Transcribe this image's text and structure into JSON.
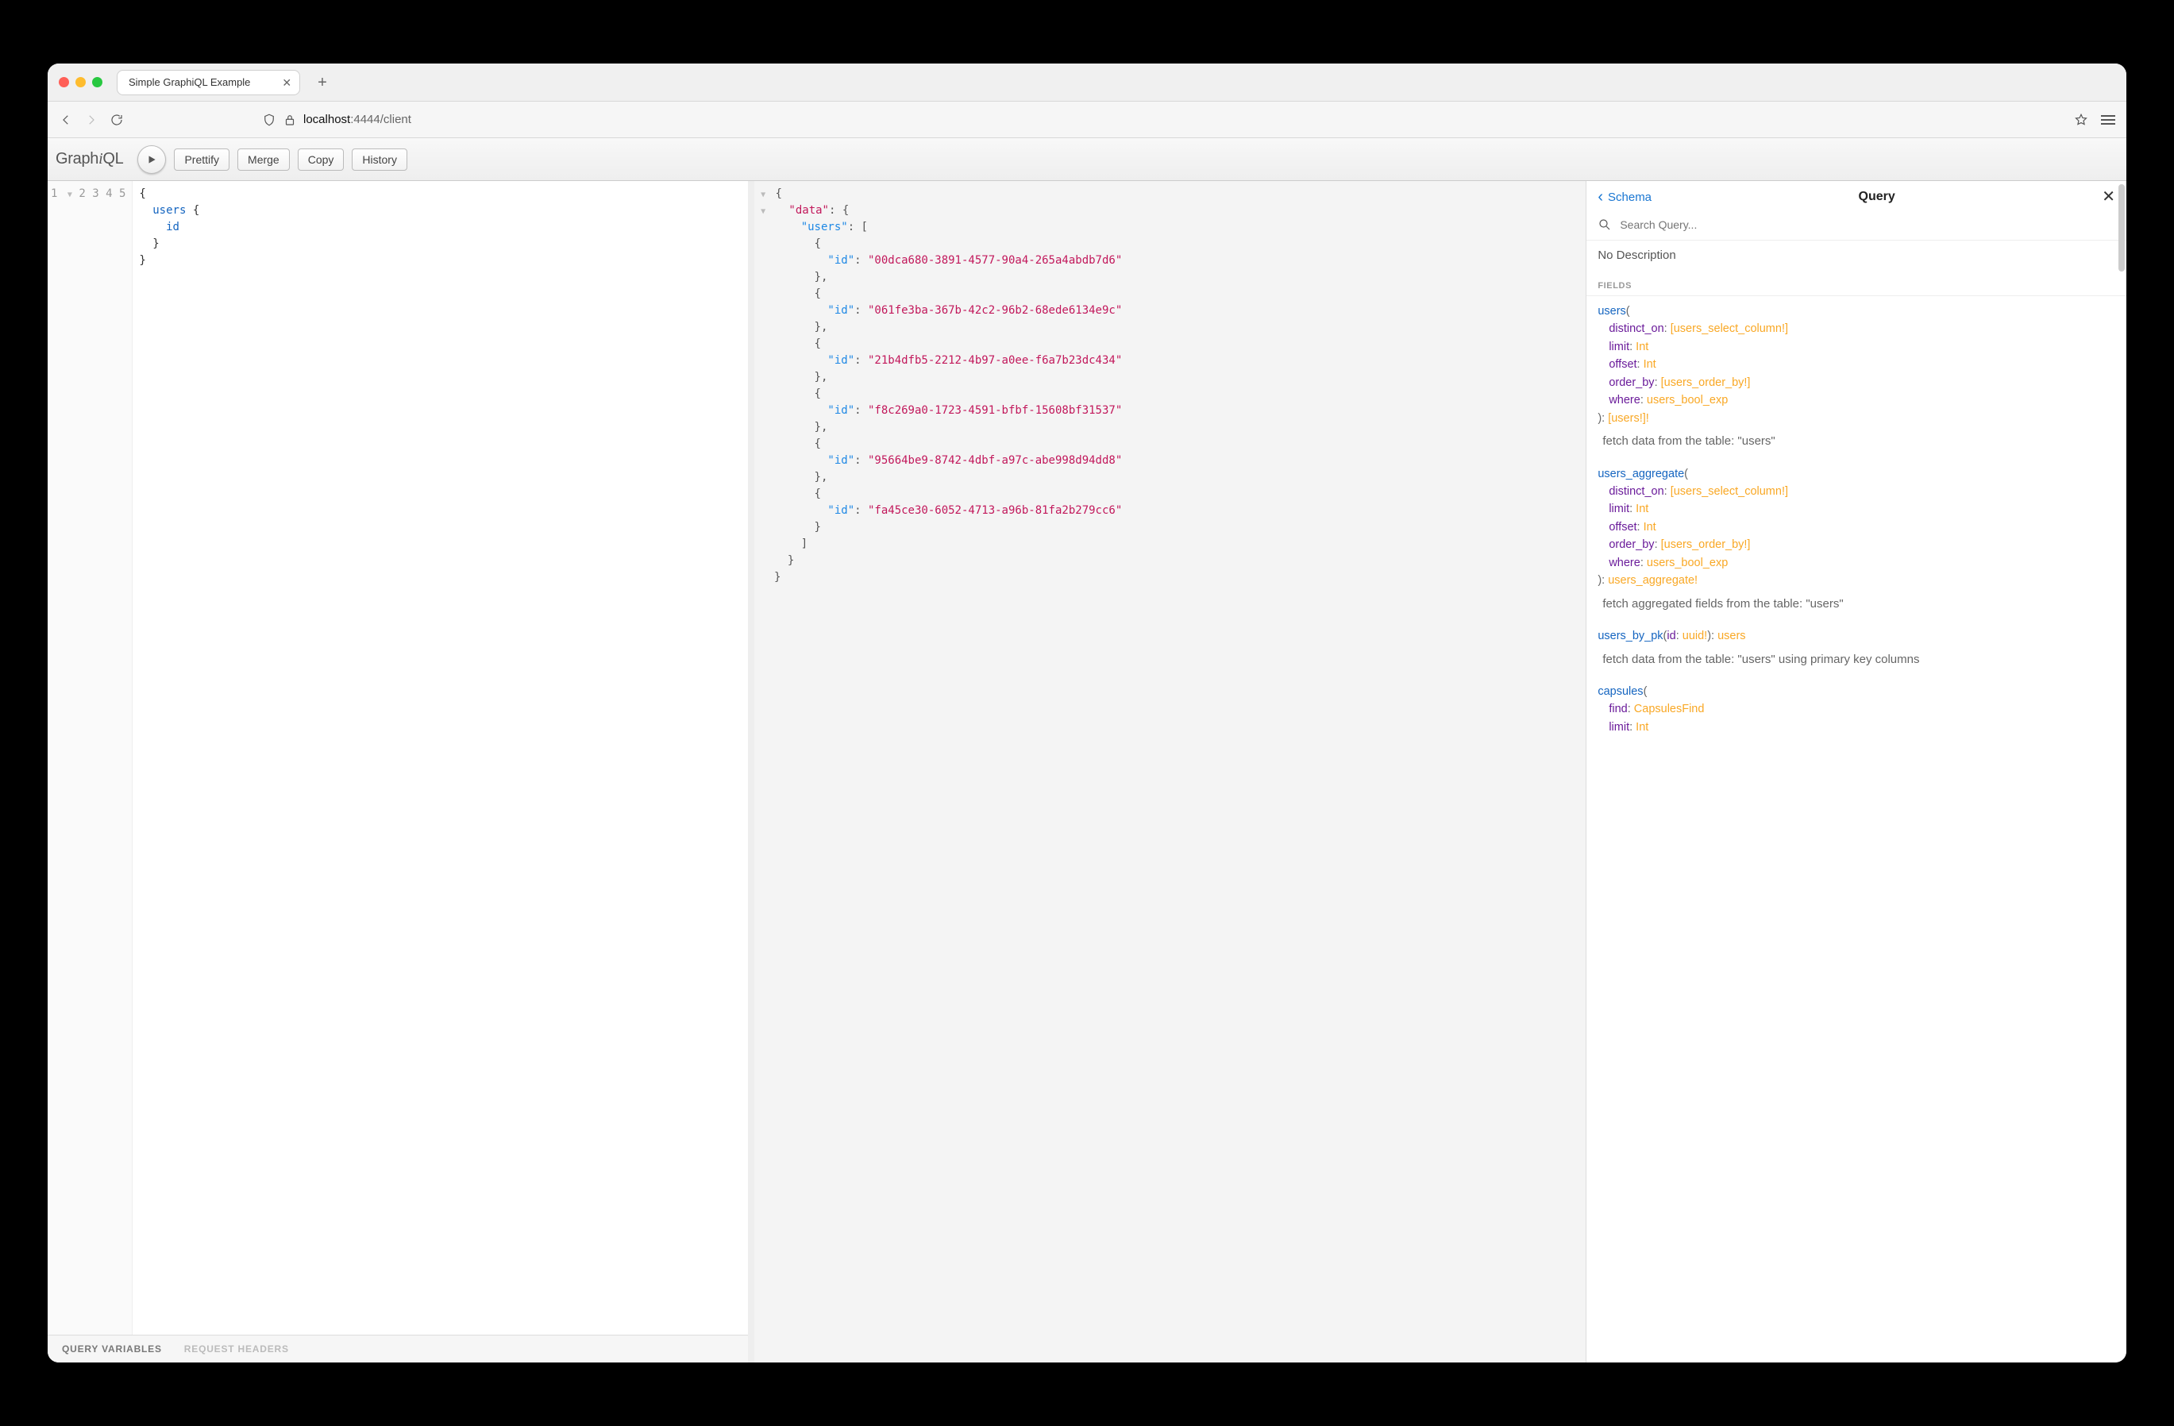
{
  "browser": {
    "tab_title": "Simple GraphiQL Example",
    "new_tab_label": "+",
    "url_host": "localhost",
    "url_path": ":4444/client"
  },
  "toolbar": {
    "logo_prefix": "Graph",
    "logo_i": "i",
    "logo_suffix": "QL",
    "prettify": "Prettify",
    "merge": "Merge",
    "copy": "Copy",
    "history": "History"
  },
  "footer": {
    "vars": "QUERY VARIABLES",
    "headers": "REQUEST HEADERS"
  },
  "query": {
    "lines": [
      "1",
      "2",
      "3",
      "4",
      "5"
    ],
    "line1": "{",
    "line2_k": "users",
    "line2_r": " {",
    "line3_k": "id",
    "line4": "  }",
    "line5": "}"
  },
  "result": {
    "data_key": "\"data\"",
    "users_key": "\"users\"",
    "id_key": "\"id\"",
    "ids": [
      "\"00dca680-3891-4577-90a4-265a4abdb7d6\"",
      "\"061fe3ba-367b-42c2-96b2-68ede6134e9c\"",
      "\"21b4dfb5-2212-4b97-a0ee-f6a7b23dc434\"",
      "\"f8c269a0-1723-4591-bfbf-15608bf31537\"",
      "\"95664be9-8742-4dbf-a97c-abe998d94dd8\"",
      "\"fa45ce30-6052-4713-a96b-81fa2b279cc6\""
    ]
  },
  "docs": {
    "back": "Schema",
    "title": "Query",
    "search_placeholder": "Search Query...",
    "no_desc": "No Description",
    "fields_label": "FIELDS",
    "fields": [
      {
        "name": "users",
        "args": [
          {
            "n": "distinct_on",
            "t": "[users_select_column!]"
          },
          {
            "n": "limit",
            "t": "Int"
          },
          {
            "n": "offset",
            "t": "Int"
          },
          {
            "n": "order_by",
            "t": "[users_order_by!]"
          },
          {
            "n": "where",
            "t": "users_bool_exp"
          }
        ],
        "return": "[users!]!",
        "doc": "fetch data from the table: \"users\""
      },
      {
        "name": "users_aggregate",
        "args": [
          {
            "n": "distinct_on",
            "t": "[users_select_column!]"
          },
          {
            "n": "limit",
            "t": "Int"
          },
          {
            "n": "offset",
            "t": "Int"
          },
          {
            "n": "order_by",
            "t": "[users_order_by!]"
          },
          {
            "n": "where",
            "t": "users_bool_exp"
          }
        ],
        "return": "users_aggregate!",
        "doc": "fetch aggregated fields from the table: \"users\""
      },
      {
        "name": "users_by_pk",
        "inline": true,
        "args": [
          {
            "n": "id",
            "t": "uuid!"
          }
        ],
        "return": "users",
        "doc": "fetch data from the table: \"users\" using primary key columns"
      },
      {
        "name": "capsules",
        "args": [
          {
            "n": "find",
            "t": "CapsulesFind"
          },
          {
            "n": "limit",
            "t": "Int"
          }
        ],
        "return": "",
        "doc": "",
        "truncated": true
      }
    ]
  }
}
